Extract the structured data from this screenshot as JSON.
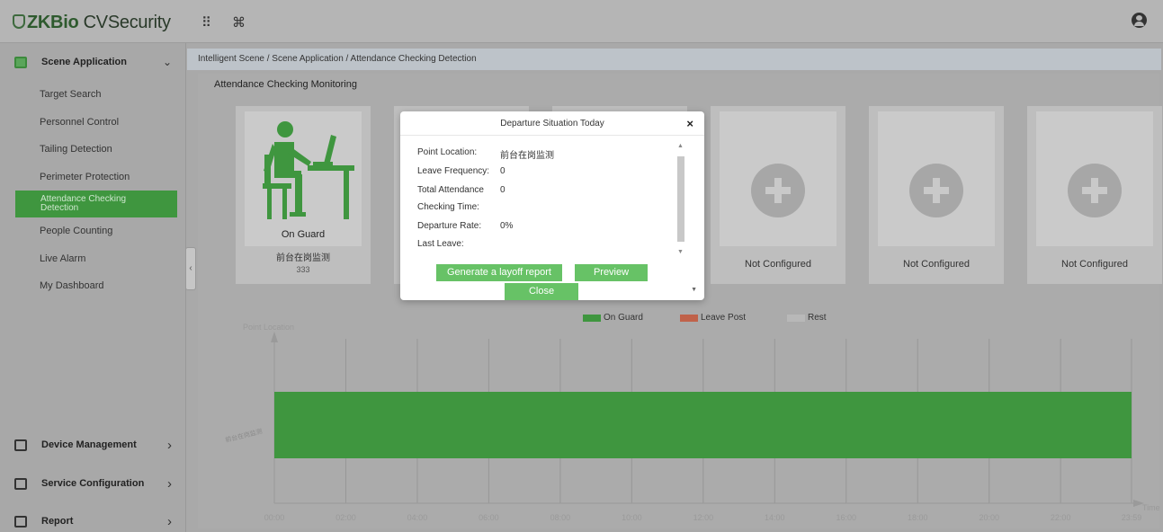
{
  "app": {
    "logo_brand": "ZKBio",
    "logo_product": " CVSecurity",
    "grid_icon": "⠿",
    "cmd_icon": "⌘"
  },
  "sidebar": {
    "scene_application": "Scene Application",
    "items": [
      "Target Search",
      "Personnel Control",
      "Tailing Detection",
      "Perimeter Protection",
      "Attendance Checking Detection",
      "People Counting",
      "Live Alarm",
      "My Dashboard"
    ],
    "active_line1": "Attendance Checking",
    "active_line2": "Detection",
    "device_management": "Device Management",
    "service_configuration": "Service Configuration",
    "report": "Report",
    "collapse_arrow": "‹",
    "chevron_down": "⌄",
    "chevron_right": "›"
  },
  "breadcrumb": "Intelligent Scene / Scene Application / Attendance Checking Detection",
  "main": {
    "title": "Attendance Checking Monitoring",
    "configured_card": {
      "status": "On Guard",
      "name": "前台在岗监测",
      "code": "333"
    },
    "not_configured_label": "Not Configured"
  },
  "chart_data": {
    "type": "bar",
    "ylabel": "Point Location",
    "xlabel": "Time",
    "x_ticks": [
      "00:00",
      "02:00",
      "04:00",
      "06:00",
      "08:00",
      "10:00",
      "12:00",
      "14:00",
      "16:00",
      "18:00",
      "20:00",
      "22:00",
      "23:59"
    ],
    "legend": [
      {
        "name": "On Guard",
        "color": "#3f963f"
      },
      {
        "name": "Leave Post",
        "color": "#c0624a"
      },
      {
        "name": "Rest",
        "color": "#b8b8b8"
      }
    ],
    "series": [
      {
        "name": "On Guard",
        "category": "前台在岗监测",
        "start": "00:00",
        "end": "23:59"
      }
    ],
    "bar_label": "前台在岗监测"
  },
  "dialog": {
    "title": "Departure Situation Today",
    "close_symbol": "×",
    "rows": [
      {
        "label": "Point Location:",
        "value": "前台在岗监测"
      },
      {
        "label": "Leave Frequency:",
        "value": "0"
      },
      {
        "label": "Total Attendance",
        "value": "0"
      },
      {
        "label": "Checking Time:",
        "value": ""
      },
      {
        "label": "Departure Rate:",
        "value": "0%"
      },
      {
        "label": "Last Leave:",
        "value": ""
      }
    ],
    "generate_button": "Generate a layoff report",
    "preview_button": "Preview",
    "close_button": "Close"
  },
  "colors": {
    "accent_green": "#67c266",
    "on_guard": "#3f963f",
    "leave_post": "#c0624a"
  }
}
